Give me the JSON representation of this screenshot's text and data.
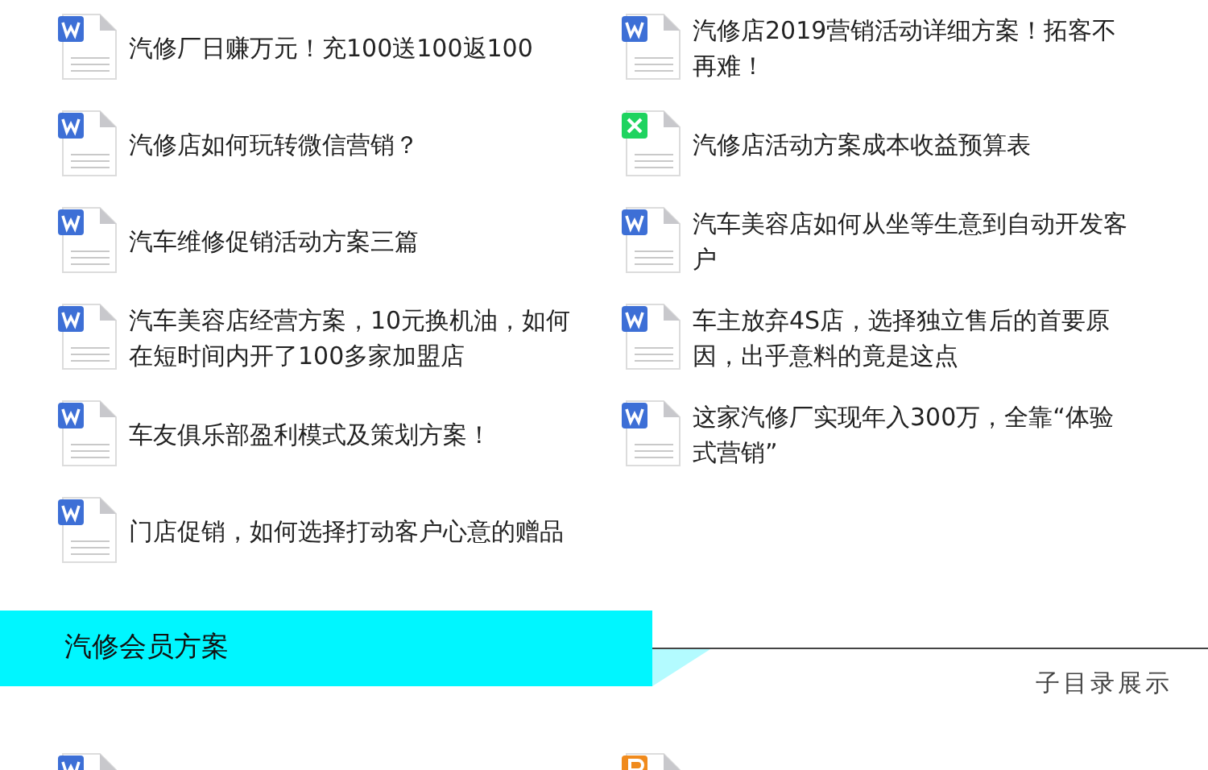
{
  "file_rows": [
    [
      {
        "kind": "word",
        "title": "汽修厂日赚万元！充100送100返100"
      },
      {
        "kind": "word",
        "title": "汽修店2019营销活动详细方案！拓客不再难！"
      }
    ],
    [
      {
        "kind": "word",
        "title": "汽修店如何玩转微信营销？"
      },
      {
        "kind": "excel",
        "title": "汽修店活动方案成本收益预算表"
      }
    ],
    [
      {
        "kind": "word",
        "title": "汽车维修促销活动方案三篇"
      },
      {
        "kind": "word",
        "title": "汽车美容店如何从坐等生意到自动开发客户"
      }
    ],
    [
      {
        "kind": "word",
        "title": "汽车美容店经营方案，10元换机油，如何在短时间内开了100多家加盟店"
      },
      {
        "kind": "word",
        "title": "车主放弃4S店，选择独立售后的首要原因，出乎意料的竟是这点"
      }
    ],
    [
      {
        "kind": "word",
        "title": "车友俱乐部盈利模式及策划方案！"
      },
      {
        "kind": "word",
        "title": "这家汽修厂实现年入300万，全靠“体验式营销”"
      }
    ],
    [
      {
        "kind": "word",
        "title": "门店促销，如何选择打动客户心意的赠品"
      }
    ]
  ],
  "section": {
    "title": "汽修会员方案",
    "link": "子目录展示"
  },
  "section_files": [
    {
      "kind": "word"
    },
    {
      "kind": "ppt"
    }
  ]
}
